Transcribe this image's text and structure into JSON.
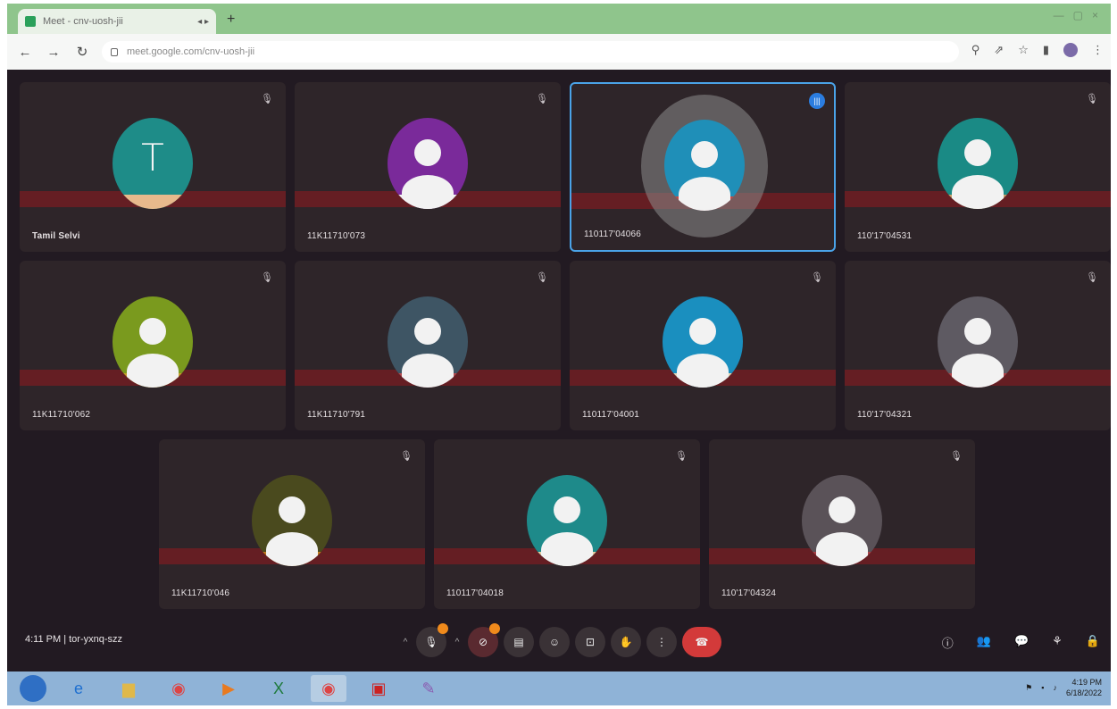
{
  "browser": {
    "tab_title": "Meet - cnv-uosh-jii",
    "tab_controls": "◂ ▸",
    "new_tab": "+",
    "url": "meet.google.com/cnv-uosh-jii",
    "window_controls": [
      "—",
      "▢",
      "×"
    ]
  },
  "tiles": [
    {
      "name": "Tamil Selvi",
      "initial": "T",
      "avatar_color": "#1e8c88",
      "band_color": "#e7b98c"
    },
    {
      "name": "11K11710'073",
      "initial": "",
      "avatar_color": "#7a2a9a",
      "band_color": "#f2f2f2"
    },
    {
      "name": "110117'04066",
      "initial": "",
      "avatar_color": "#1f8fb8",
      "band_color": "#c44a44",
      "speaking": true
    },
    {
      "name": "110'17'04531",
      "initial": "",
      "avatar_color": "#1a8a85",
      "band_color": "#c9a06a"
    },
    {
      "name": "11K11710'062",
      "initial": "",
      "avatar_color": "#7a9a1e",
      "band_color": "#c69c2a"
    },
    {
      "name": "11K11710'791",
      "initial": "",
      "avatar_color": "#3e5564",
      "band_color": "#b44a4e"
    },
    {
      "name": "110117'04001",
      "initial": "",
      "avatar_color": "#1a8fbf",
      "band_color": "#e6d6b4"
    },
    {
      "name": "110'17'04321",
      "initial": "",
      "avatar_color": "#5e5a62",
      "band_color": "#b04248"
    },
    {
      "name": "11K11710'046",
      "initial": "",
      "avatar_color": "#4a4a1e",
      "band_color": "#c07a1e"
    },
    {
      "name": "110117'04018",
      "initial": "",
      "avatar_color": "#1e8a8a",
      "band_color": "#e8d2a4"
    },
    {
      "name": "110'17'04324",
      "initial": "",
      "avatar_color": "#5a5258",
      "band_color": "#a84046"
    }
  ],
  "controls": {
    "time_code": "4:11 PM  |  tor-yxnq-szz"
  },
  "taskbar": {
    "time": "4:19 PM",
    "date": "6/18/2022"
  }
}
